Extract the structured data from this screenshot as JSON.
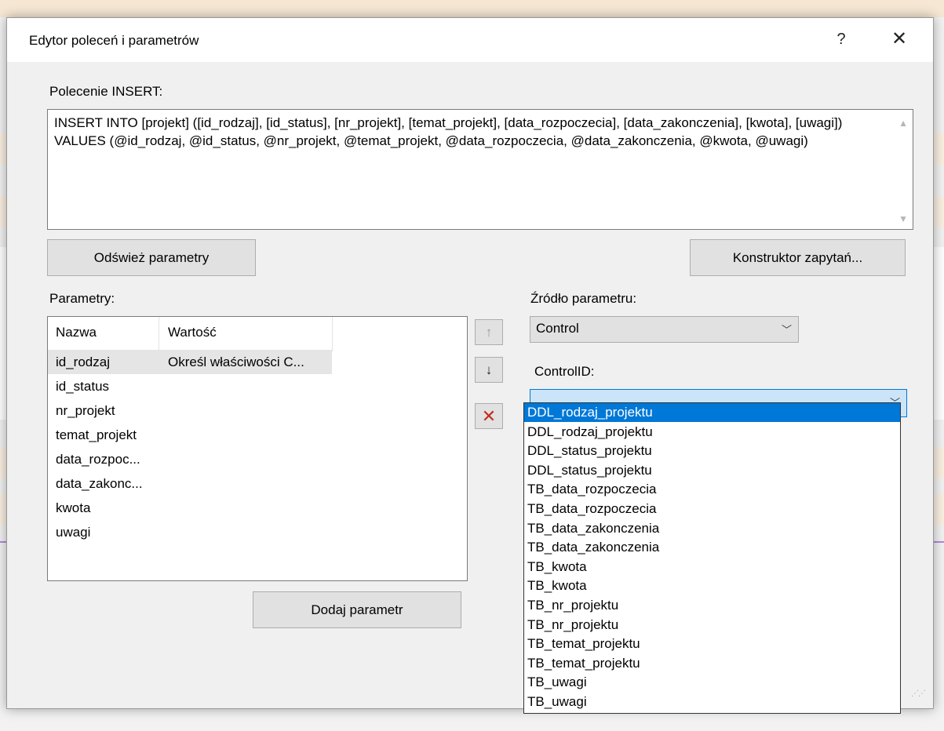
{
  "dialog": {
    "title": "Edytor poleceń i parametrów",
    "help_label": "?",
    "close_label": "✕"
  },
  "insert": {
    "label": "Polecenie INSERT:",
    "sql": "INSERT INTO [projekt] ([id_rodzaj], [id_status], [nr_projekt], [temat_projekt], [data_rozpoczecia], [data_zakonczenia], [kwota], [uwagi]) VALUES (@id_rodzaj, @id_status, @nr_projekt, @temat_projekt, @data_rozpoczecia, @data_zakonczenia, @kwota, @uwagi)"
  },
  "buttons": {
    "refresh": "Odśwież parametry",
    "query_builder": "Konstruktor zapytań...",
    "add_param": "Dodaj parametr"
  },
  "params": {
    "label": "Parametry:",
    "col_name": "Nazwa",
    "col_value": "Wartość",
    "rows": [
      {
        "name": "id_rodzaj",
        "value": "Określ właściwości C..."
      },
      {
        "name": "id_status",
        "value": ""
      },
      {
        "name": "nr_projekt",
        "value": ""
      },
      {
        "name": "temat_projekt",
        "value": ""
      },
      {
        "name": "data_rozpoc...",
        "value": ""
      },
      {
        "name": "data_zakonc...",
        "value": ""
      },
      {
        "name": "kwota",
        "value": ""
      },
      {
        "name": "uwagi",
        "value": ""
      }
    ]
  },
  "side_buttons": {
    "up": "↑",
    "down": "↓",
    "remove": "✕"
  },
  "source": {
    "label": "Źródło parametru:",
    "value": "Control"
  },
  "control": {
    "label": "ControlID:",
    "value": "",
    "options": [
      "DDL_rodzaj_projektu",
      "DDL_rodzaj_projektu",
      "DDL_status_projektu",
      "DDL_status_projektu",
      "TB_data_rozpoczecia",
      "TB_data_rozpoczecia",
      "TB_data_zakonczenia",
      "TB_data_zakonczenia",
      "TB_kwota",
      "TB_kwota",
      "TB_nr_projektu",
      "TB_nr_projektu",
      "TB_temat_projektu",
      "TB_temat_projektu",
      "TB_uwagi",
      "TB_uwagi"
    ],
    "highlighted_index": 0
  },
  "colors": {
    "highlight": "#0078d7",
    "remove_icon": "#c42b1c",
    "dialog_bg": "#f0f0f0"
  }
}
